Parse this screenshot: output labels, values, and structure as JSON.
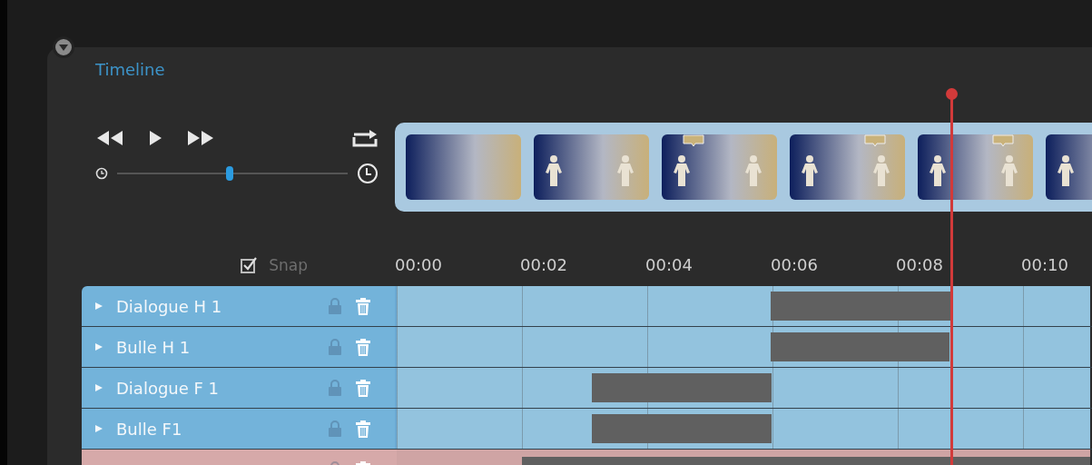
{
  "panel": {
    "title": "Timeline",
    "collapsed": false
  },
  "playback": {
    "zoom": {
      "level": 0.49
    },
    "loop": true
  },
  "thumbnails": [
    {
      "figures": false,
      "bubble_left": false,
      "bubble_right": false
    },
    {
      "figures": true,
      "bubble_left": false,
      "bubble_right": false
    },
    {
      "figures": true,
      "bubble_left": true,
      "bubble_right": false
    },
    {
      "figures": true,
      "bubble_left": false,
      "bubble_right": true
    },
    {
      "figures": true,
      "bubble_left": false,
      "bubble_right": true
    },
    {
      "figures": true,
      "bubble_left": false,
      "bubble_right": false
    }
  ],
  "snap": {
    "label": "Snap",
    "checked": true
  },
  "ruler": [
    "00:00",
    "00:02",
    "00:04",
    "00:06",
    "00:08",
    "00:10"
  ],
  "tracks": [
    {
      "name": "Dialogue H 1",
      "kind": "blue",
      "locked": false
    },
    {
      "name": "Bulle H 1",
      "kind": "blue",
      "locked": false
    },
    {
      "name": "Dialogue F 1",
      "kind": "blue",
      "locked": false
    },
    {
      "name": "Bulle F1",
      "kind": "blue",
      "locked": false
    },
    {
      "kind": "pink",
      "locked": false
    }
  ]
}
